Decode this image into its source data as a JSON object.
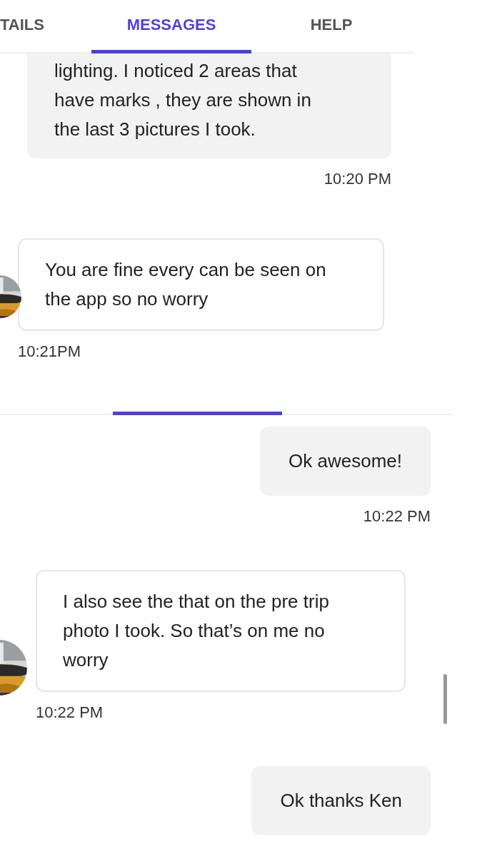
{
  "screens": [
    {
      "tabs": [
        {
          "label": "TAILS",
          "selected": false
        },
        {
          "label": "MESSAGES",
          "selected": true
        },
        {
          "label": "HELP",
          "selected": false
        }
      ],
      "messages": [
        {
          "kind": "outgoing",
          "text": "lighting. I noticed 2 areas that have marks , they are shown in the last 3 pictures I took.",
          "time": "10:20 PM"
        },
        {
          "kind": "incoming",
          "text": "You are fine every can be seen on the app so no worry",
          "time": "10:21PM"
        }
      ]
    },
    {
      "tabs": [
        {
          "selected": false
        },
        {
          "selected": true
        },
        {
          "selected": false
        }
      ],
      "messages": [
        {
          "kind": "outgoing",
          "text": "Ok awesome!",
          "time": "10:22 PM"
        },
        {
          "kind": "incoming",
          "text": "I also see the that on the pre trip photo I took. So that’s on me no worry",
          "time": "10:22 PM"
        },
        {
          "kind": "outgoing",
          "text": "Ok thanks Ken"
        }
      ]
    }
  ]
}
